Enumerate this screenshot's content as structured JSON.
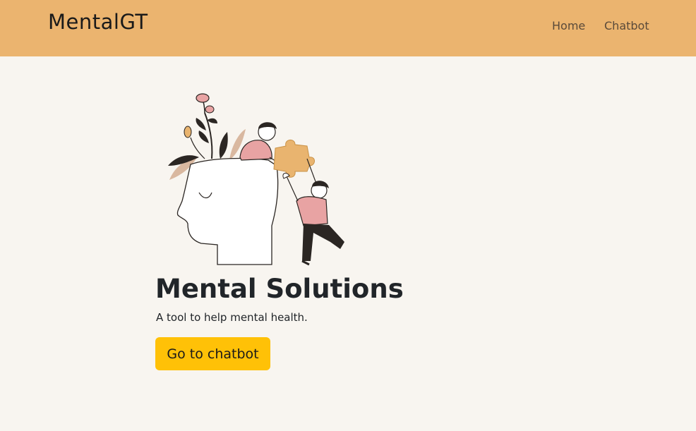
{
  "navbar": {
    "brand": "MentalGT",
    "links": [
      {
        "label": "Home"
      },
      {
        "label": "Chatbot"
      }
    ],
    "background": "#ebb46f"
  },
  "hero": {
    "title": "Mental Solutions",
    "subtitle": "A tool to help mental health.",
    "cta_label": "Go to chatbot",
    "cta_color": "#ffc107"
  },
  "illustration": {
    "icon": "head-puzzle-illustration"
  }
}
